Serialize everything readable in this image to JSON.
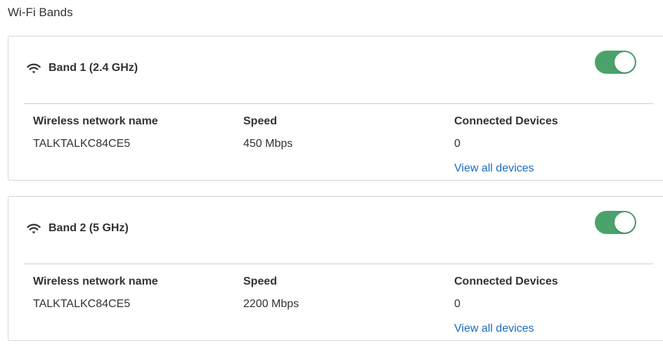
{
  "page": {
    "title": "Wi-Fi Bands"
  },
  "colors": {
    "toggle_on": "#4aa36a",
    "link": "#1a6bbf",
    "border": "#d6d6d6"
  },
  "bands": [
    {
      "title": "Band 1 (2.4 GHz)",
      "icon": "wifi-icon",
      "enabled": true,
      "columns": {
        "network_name_label": "Wireless network name",
        "network_name_value": "TALKTALKC84CE5",
        "speed_label": "Speed",
        "speed_value": "450 Mbps",
        "devices_label": "Connected Devices",
        "devices_value": "0",
        "view_all_label": "View all devices"
      }
    },
    {
      "title": "Band 2 (5 GHz)",
      "icon": "wifi-icon",
      "enabled": true,
      "columns": {
        "network_name_label": "Wireless network name",
        "network_name_value": "TALKTALKC84CE5",
        "speed_label": "Speed",
        "speed_value": "2200 Mbps",
        "devices_label": "Connected Devices",
        "devices_value": "0",
        "view_all_label": "View all devices"
      }
    }
  ]
}
